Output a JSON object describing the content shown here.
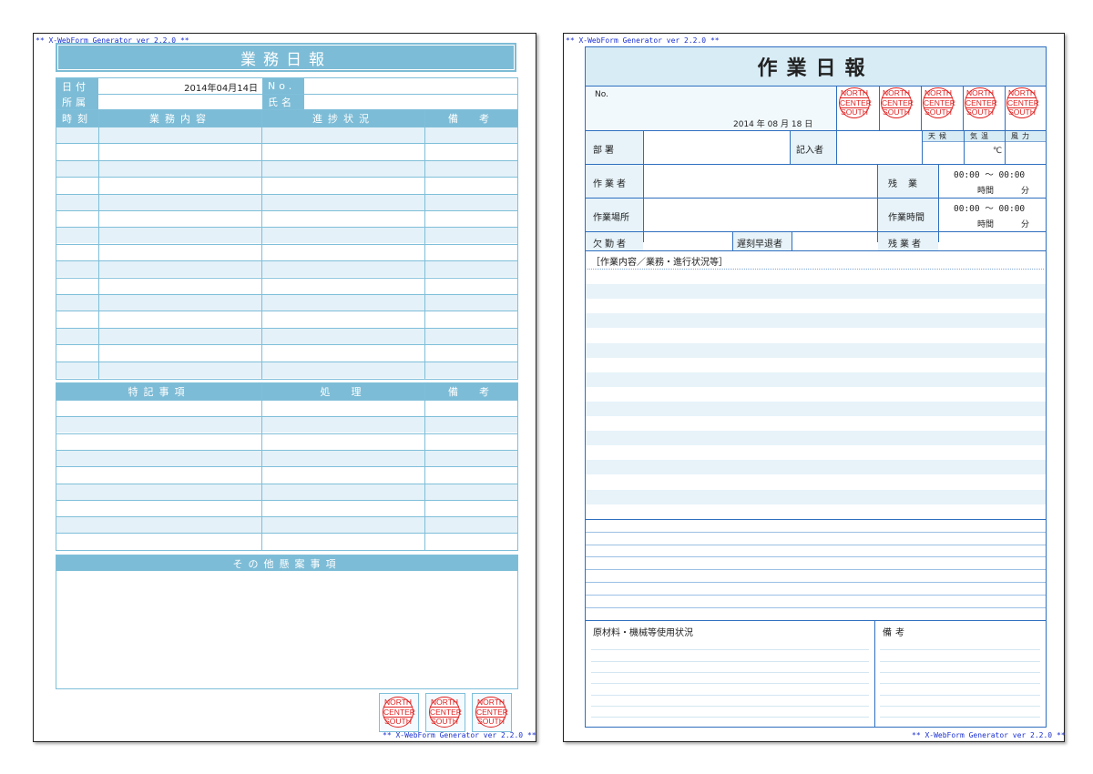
{
  "report1": {
    "generator_top": "** X-WebForm Generator ver 2.2.0 **",
    "title": "業務日報",
    "date_label": "日付",
    "date_value": "2014年04月14日",
    "no_label": "No.",
    "dept_label": "所属",
    "name_label": "氏名",
    "columns": [
      "時刻",
      "業務内容",
      "進捗状況",
      "備　考"
    ],
    "notes_columns": [
      "特記事項",
      "処　理",
      "備　考"
    ],
    "pending_label": "その他懸案事項",
    "stamps": [
      [
        "NORTH",
        "CENTER",
        "SOUTH"
      ],
      [
        "NORTH",
        "CENTER",
        "SOUTH"
      ],
      [
        "NORTH",
        "CENTER",
        "SOUTH"
      ]
    ],
    "generator_bottom": "** X-WebForm Generator ver 2.2.0 **"
  },
  "report2": {
    "generator_top": "** X-WebForm Generator ver 2.2.0 **",
    "title": "作業日報",
    "no_label": "No.",
    "date_year": "2014",
    "date_month": "08",
    "date_day": "18",
    "year_unit": "年",
    "month_unit": "月",
    "day_unit": "日",
    "stamps": [
      [
        "NORTH",
        "CENTER",
        "SOUTH"
      ],
      [
        "NORTH",
        "CENTER",
        "SOUTH"
      ],
      [
        "NORTH",
        "CENTER",
        "SOUTH"
      ],
      [
        "NORTH",
        "CENTER",
        "SOUTH"
      ],
      [
        "NORTH",
        "CENTER",
        "SOUTH"
      ]
    ],
    "weather_label": "天候",
    "temp_label": "気温",
    "wind_label": "風力",
    "temp_unit": "℃",
    "dept_label": "部署",
    "recorder_label": "記入者",
    "worker_label": "作業者",
    "overtime_label": "残業",
    "time_range": "00:00 ～ 00:00",
    "hours_label": "時間",
    "minutes_label": "分",
    "place_label": "作業場所",
    "work_time_label": "作業時間",
    "absent_label": "欠勤者",
    "late_label": "遅刻早退者",
    "overtime_person_label": "残業者",
    "content_label": "［作業内容／業務・進行状況等］",
    "materials_label": "原材料・機械等使用状況",
    "remarks_label": "備考",
    "generator_bottom": "** X-WebForm Generator ver 2.2.0 **"
  }
}
